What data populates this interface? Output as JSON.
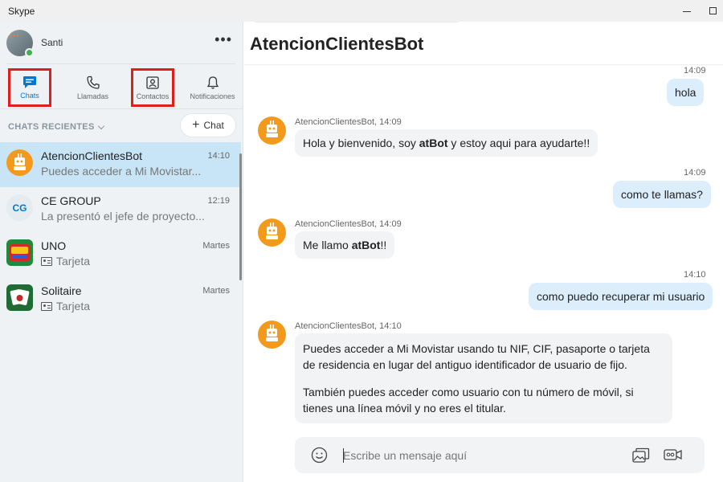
{
  "window": {
    "title": "Skype"
  },
  "profile": {
    "name": "Santi",
    "more": "•••"
  },
  "nav": {
    "chats": "Chats",
    "calls": "Llamadas",
    "contacts": "Contactos",
    "notifications": "Notificaciones"
  },
  "recent": {
    "header": "CHATS RECIENTES",
    "new_chat": "Chat"
  },
  "chats": [
    {
      "name": "AtencionClientesBot",
      "time": "14:10",
      "preview": "Puedes acceder a Mi Movistar..."
    },
    {
      "name": "CE GROUP",
      "time": "12:19",
      "preview": "La presentó el jefe de proyecto...",
      "initials": "CG"
    },
    {
      "name": "UNO",
      "time": "Martes",
      "preview": "Tarjeta"
    },
    {
      "name": "Solitaire",
      "time": "Martes",
      "preview": "Tarjeta"
    }
  ],
  "conversation": {
    "title": "AtencionClientesBot",
    "messages": [
      {
        "time": "14:09",
        "text": "hola"
      },
      {
        "sender": "AtencionClientesBot, 14:09",
        "pre": "Hola y bienvenido, soy ",
        "bold": "atBot",
        "post": " y estoy aqui para ayudarte!!"
      },
      {
        "time": "14:09",
        "text": "como te llamas?"
      },
      {
        "sender": "AtencionClientesBot, 14:09",
        "pre": "Me llamo ",
        "bold": "atBot",
        "post": "!!"
      },
      {
        "time": "14:10",
        "text": "como puedo recuperar mi usuario"
      },
      {
        "sender": "AtencionClientesBot, 14:10",
        "p1": "Puedes acceder a Mi Movistar usando tu NIF, CIF, pasaporte o tarjeta de residencia en lugar del antiguo identificador de usuario de fijo.",
        "p2": "También puedes acceder como usuario con tu número de móvil, si tienes una línea móvil y no eres el titular."
      }
    ]
  },
  "composer": {
    "placeholder": "Escribe un mensaje aquí"
  },
  "colors": {
    "accent": "#0078d4",
    "highlight": "#e01e1e",
    "bot": "#f39a1d",
    "selected": "#c7e5f6"
  }
}
